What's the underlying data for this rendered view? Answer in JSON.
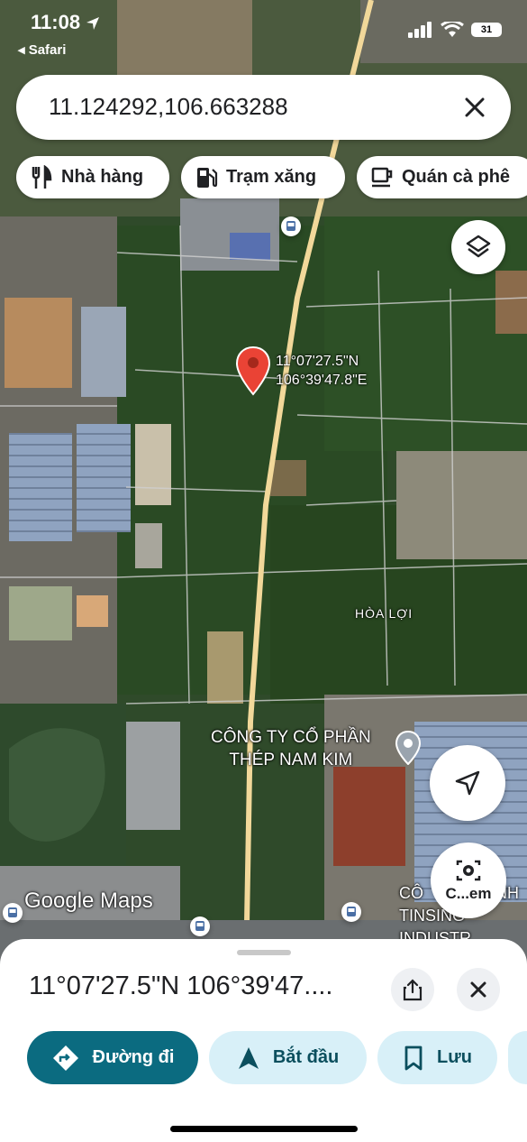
{
  "status_bar": {
    "time": "11:08",
    "back_label": "◂ Safari",
    "battery": "31"
  },
  "search": {
    "query": "11.124292,106.663288"
  },
  "chips": [
    {
      "label": "Nhà hàng",
      "icon": "restaurant-icon"
    },
    {
      "label": "Trạm xăng",
      "icon": "gas-station-icon"
    },
    {
      "label": "Quán cà phê",
      "icon": "coffee-icon"
    }
  ],
  "map": {
    "pin_lat": "11°07'27.5\"N",
    "pin_lng": "106°39'47.8\"E",
    "area_label": "HÒA LỢI",
    "poi1_line1": "CÔNG TY CỔ PHẦN",
    "poi1_line2": "THÉP NAM KIM",
    "poi2_line1": "CÔ",
    "poi2_line1b": "NH",
    "poi2_line2": "TINSING INDUSTR",
    "logo": "Google Maps",
    "lens_label": "C...em"
  },
  "sheet": {
    "title": "11°07'27.5\"N 106°39'47....",
    "buttons": {
      "directions": "Đường đi",
      "start": "Bắt đầu",
      "save": "Lưu"
    }
  },
  "colors": {
    "accent": "#0b6b80",
    "light_button": "#d8f0f8",
    "pin": "#ea4335"
  }
}
